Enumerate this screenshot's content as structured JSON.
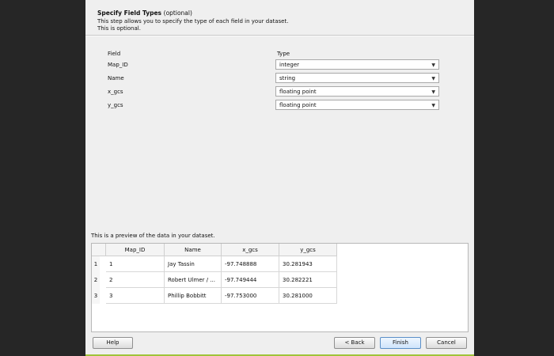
{
  "header": {
    "title": "Specify Field Types",
    "title_suffix": "(optional)",
    "description_1": "This step allows you to specify the type of each field in your dataset.",
    "description_2": "This is optional."
  },
  "fields": {
    "field_header": "Field",
    "type_header": "Type",
    "items": [
      {
        "name": "Map_ID",
        "type": "integer"
      },
      {
        "name": "Name",
        "type": "string"
      },
      {
        "name": "x_gcs",
        "type": "floating point"
      },
      {
        "name": "y_gcs",
        "type": "floating point"
      }
    ]
  },
  "preview": {
    "label": "This is a preview of the data in your dataset.",
    "columns": [
      "Map_ID",
      "Name",
      "x_gcs",
      "y_gcs"
    ],
    "rows": [
      {
        "num": "1",
        "cells": [
          "1",
          "Jay Tassin",
          "-97.748888",
          "30.281943"
        ]
      },
      {
        "num": "2",
        "cells": [
          "2",
          "Robert Ulmer / ...",
          "-97.749444",
          "30.282221"
        ]
      },
      {
        "num": "3",
        "cells": [
          "3",
          "Phillip Bobbitt",
          "-97.753000",
          "30.281000"
        ]
      }
    ]
  },
  "buttons": {
    "help": "Help",
    "back": "< Back",
    "finish": "Finish",
    "cancel": "Cancel"
  },
  "icons": {
    "dropdown": "chevron-down-icon"
  }
}
